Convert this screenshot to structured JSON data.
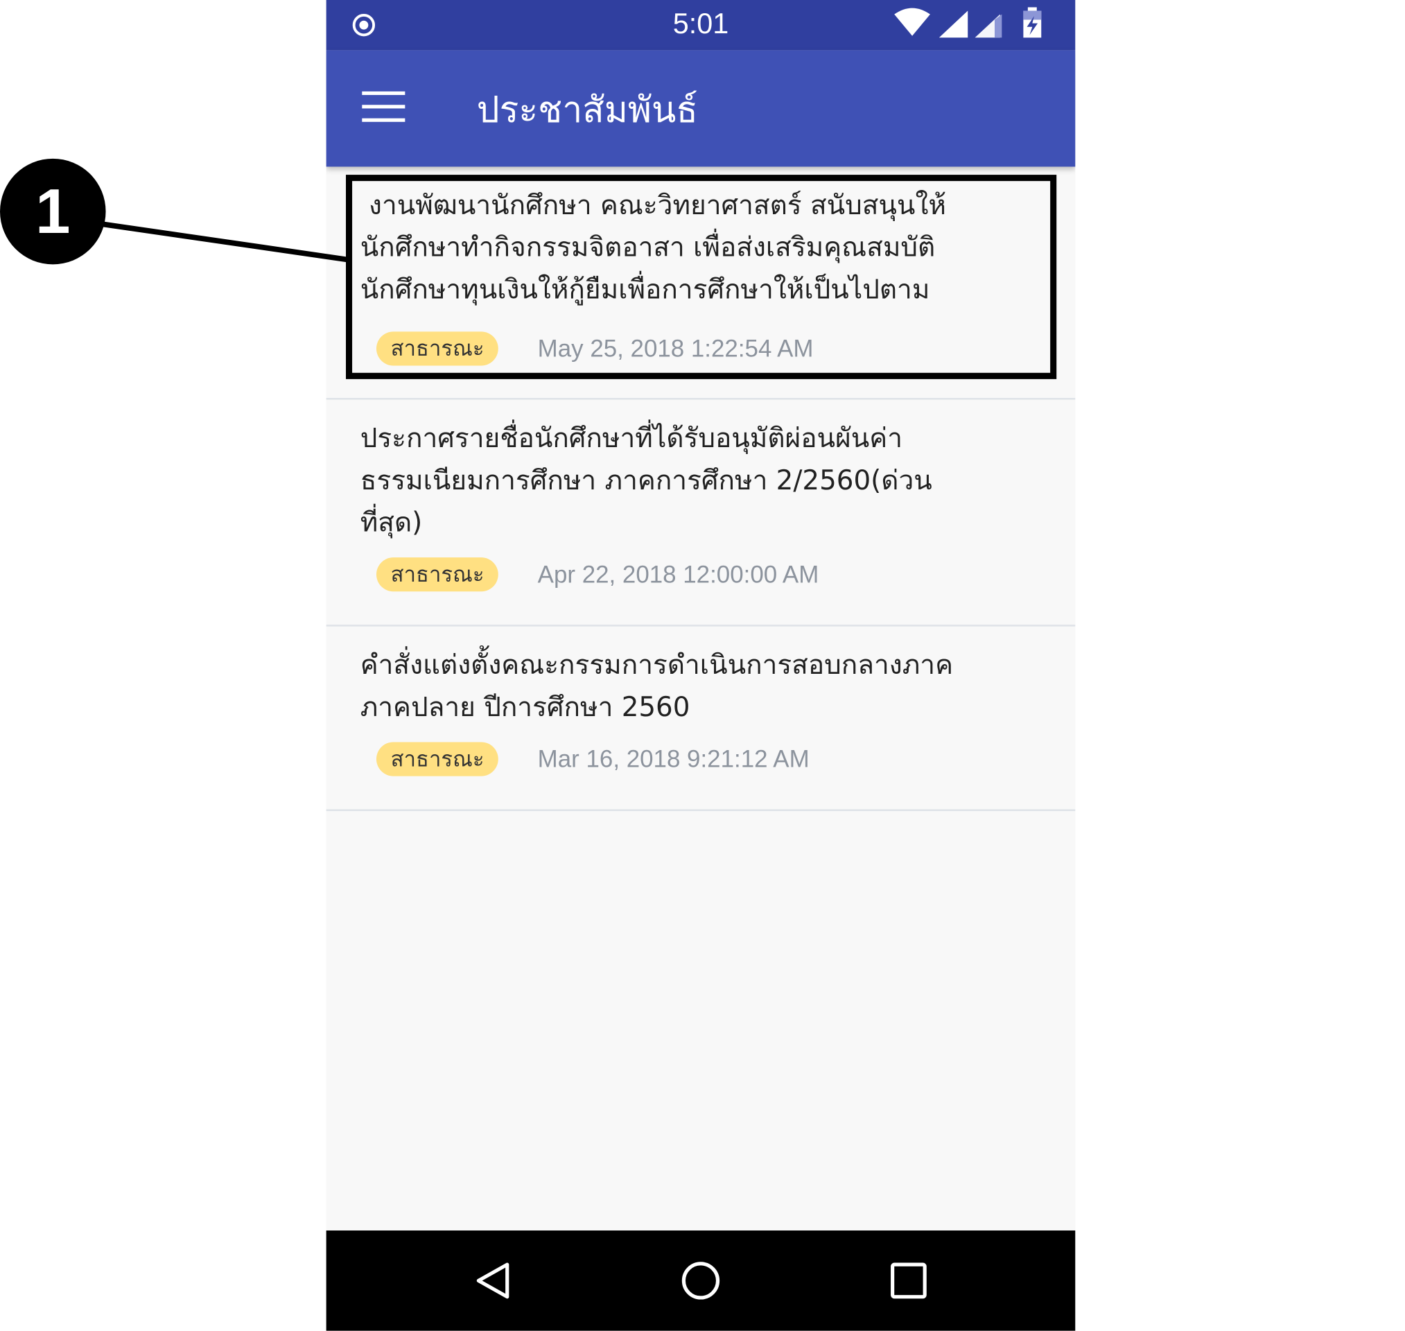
{
  "status_bar": {
    "time": "5:01",
    "icons": [
      "target-icon",
      "wifi-icon",
      "signal-icon",
      "signal-icon",
      "battery-charging-icon"
    ]
  },
  "app_bar": {
    "title": "ประชาสัมพันธ์",
    "menu_icon": "menu-icon"
  },
  "announcements": [
    {
      "title_lines": [
        " งานพัฒนานักศึกษา คณะวิทยาศาสตร์ สนับสนุนให้",
        "นักศึกษาทำกิจกรรมจิตอาสา เพื่อส่งเสริมคุณสมบัติ",
        "นักศึกษาทุนเงินให้กู้ยืมเพื่อการศึกษาให้เป็นไปตาม"
      ],
      "badge": "สาธารณะ",
      "date": "May 25, 2018 1:22:54 AM"
    },
    {
      "title_lines": [
        "ประกาศรายชื่อนักศึกษาที่ได้รับอนุมัติผ่อนผันค่า",
        "ธรรมเนียมการศึกษา ภาคการศึกษา 2/2560(ด่วน",
        "ที่สุด)"
      ],
      "badge": "สาธารณะ",
      "date": "Apr 22, 2018 12:00:00 AM"
    },
    {
      "title_lines": [
        "คำสั่งแต่งตั้งคณะกรรมการดำเนินการสอบกลางภาค",
        "ภาคปลาย ปีการศึกษา 2560"
      ],
      "badge": "สาธารณะ",
      "date": "Mar 16, 2018 9:21:12 AM"
    }
  ],
  "annotation": {
    "number": "1"
  },
  "nav_bar": {
    "icons": [
      "back-icon",
      "home-icon",
      "recents-icon"
    ]
  },
  "colors": {
    "status_bar": "#303f9f",
    "app_bar": "#3f51b5",
    "badge": "#ffe082",
    "date_text": "#8c939d",
    "background": "#f8f8f8"
  }
}
